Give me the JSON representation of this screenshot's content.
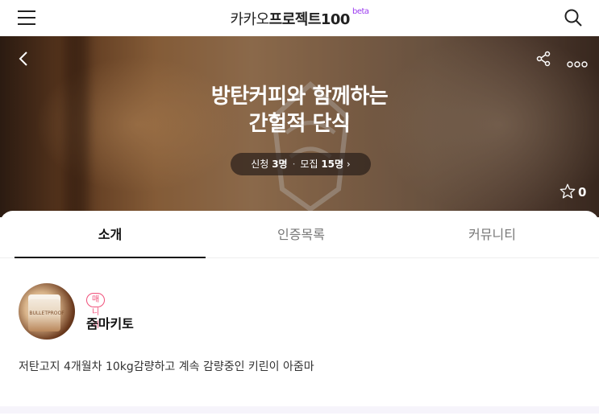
{
  "header": {
    "brand_main": "카카오",
    "brand_bold": "프로젝트100",
    "brand_beta": "beta",
    "icons": {
      "menu": "hamburger-menu-icon",
      "search": "search-icon"
    }
  },
  "hero": {
    "title_line1": "방탄커피와 함께하는",
    "title_line2": "간헐적 단식",
    "stats": {
      "applied_label": "신청",
      "applied_count": "3명",
      "recruit_label": "모집",
      "recruit_count": "15명",
      "separator": "·",
      "chevron": "›"
    },
    "favorite_count": "0",
    "icons": {
      "back": "chevron-left-icon",
      "share": "share-icon",
      "more": "more-dots-icon",
      "favorite": "star-icon"
    }
  },
  "tabs": [
    {
      "label": "소개",
      "active": true
    },
    {
      "label": "인증목록",
      "active": false
    },
    {
      "label": "커뮤니티",
      "active": false
    }
  ],
  "manager": {
    "badge": "매니저",
    "name": "줌마키토",
    "avatar_caption": "BULLETPROOF"
  },
  "intro_text": "저탄고지 4개월차 10kg감량하고 계속 감량중인 키린이 아줌마",
  "colors": {
    "accent_pink": "#f0507a",
    "beta_purple": "#9b3cf0"
  }
}
